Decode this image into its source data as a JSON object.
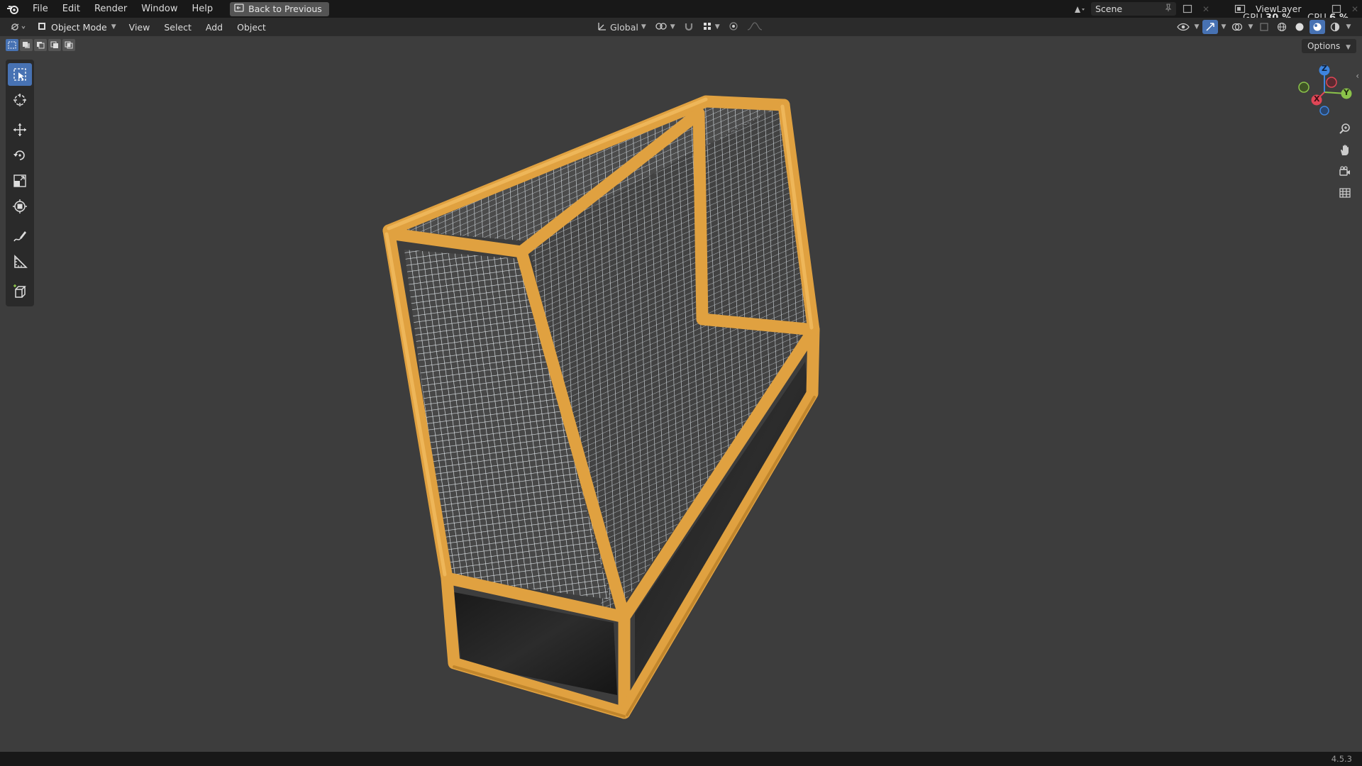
{
  "topbar": {
    "menus": [
      "File",
      "Edit",
      "Render",
      "Window",
      "Help"
    ],
    "back_button": "Back to Previous",
    "scene_label": "Scene",
    "viewlayer_label": "ViewLayer",
    "gpu_label": "GPU",
    "gpu_value": "30 %",
    "cpu_label": "CPU",
    "cpu_value": "6 %"
  },
  "header": {
    "mode": "Object Mode",
    "menus": [
      "View",
      "Select",
      "Add",
      "Object"
    ],
    "transform_orientation": "Global"
  },
  "options_label": "Options",
  "gizmo": {
    "x": "X",
    "y": "Y",
    "z": "Z"
  },
  "status": {
    "version": "4.5.3"
  },
  "colors": {
    "accent": "#4772b3",
    "frame_orange": "#e0a140",
    "viewport_bg": "#3d3d3d",
    "axis_x": "#e04656",
    "axis_y": "#8bc34a",
    "axis_z": "#3d85e0"
  },
  "icons": [
    "blender-logo-icon",
    "back-icon",
    "scene-icon",
    "pin-icon",
    "viewlayer-icon",
    "select-box-icon",
    "cursor-icon",
    "move-icon",
    "rotate-icon",
    "scale-icon",
    "transform-icon",
    "annotate-icon",
    "measure-icon",
    "add-cube-icon",
    "zoom-icon",
    "hand-icon",
    "camera-icon",
    "grid-icon"
  ]
}
